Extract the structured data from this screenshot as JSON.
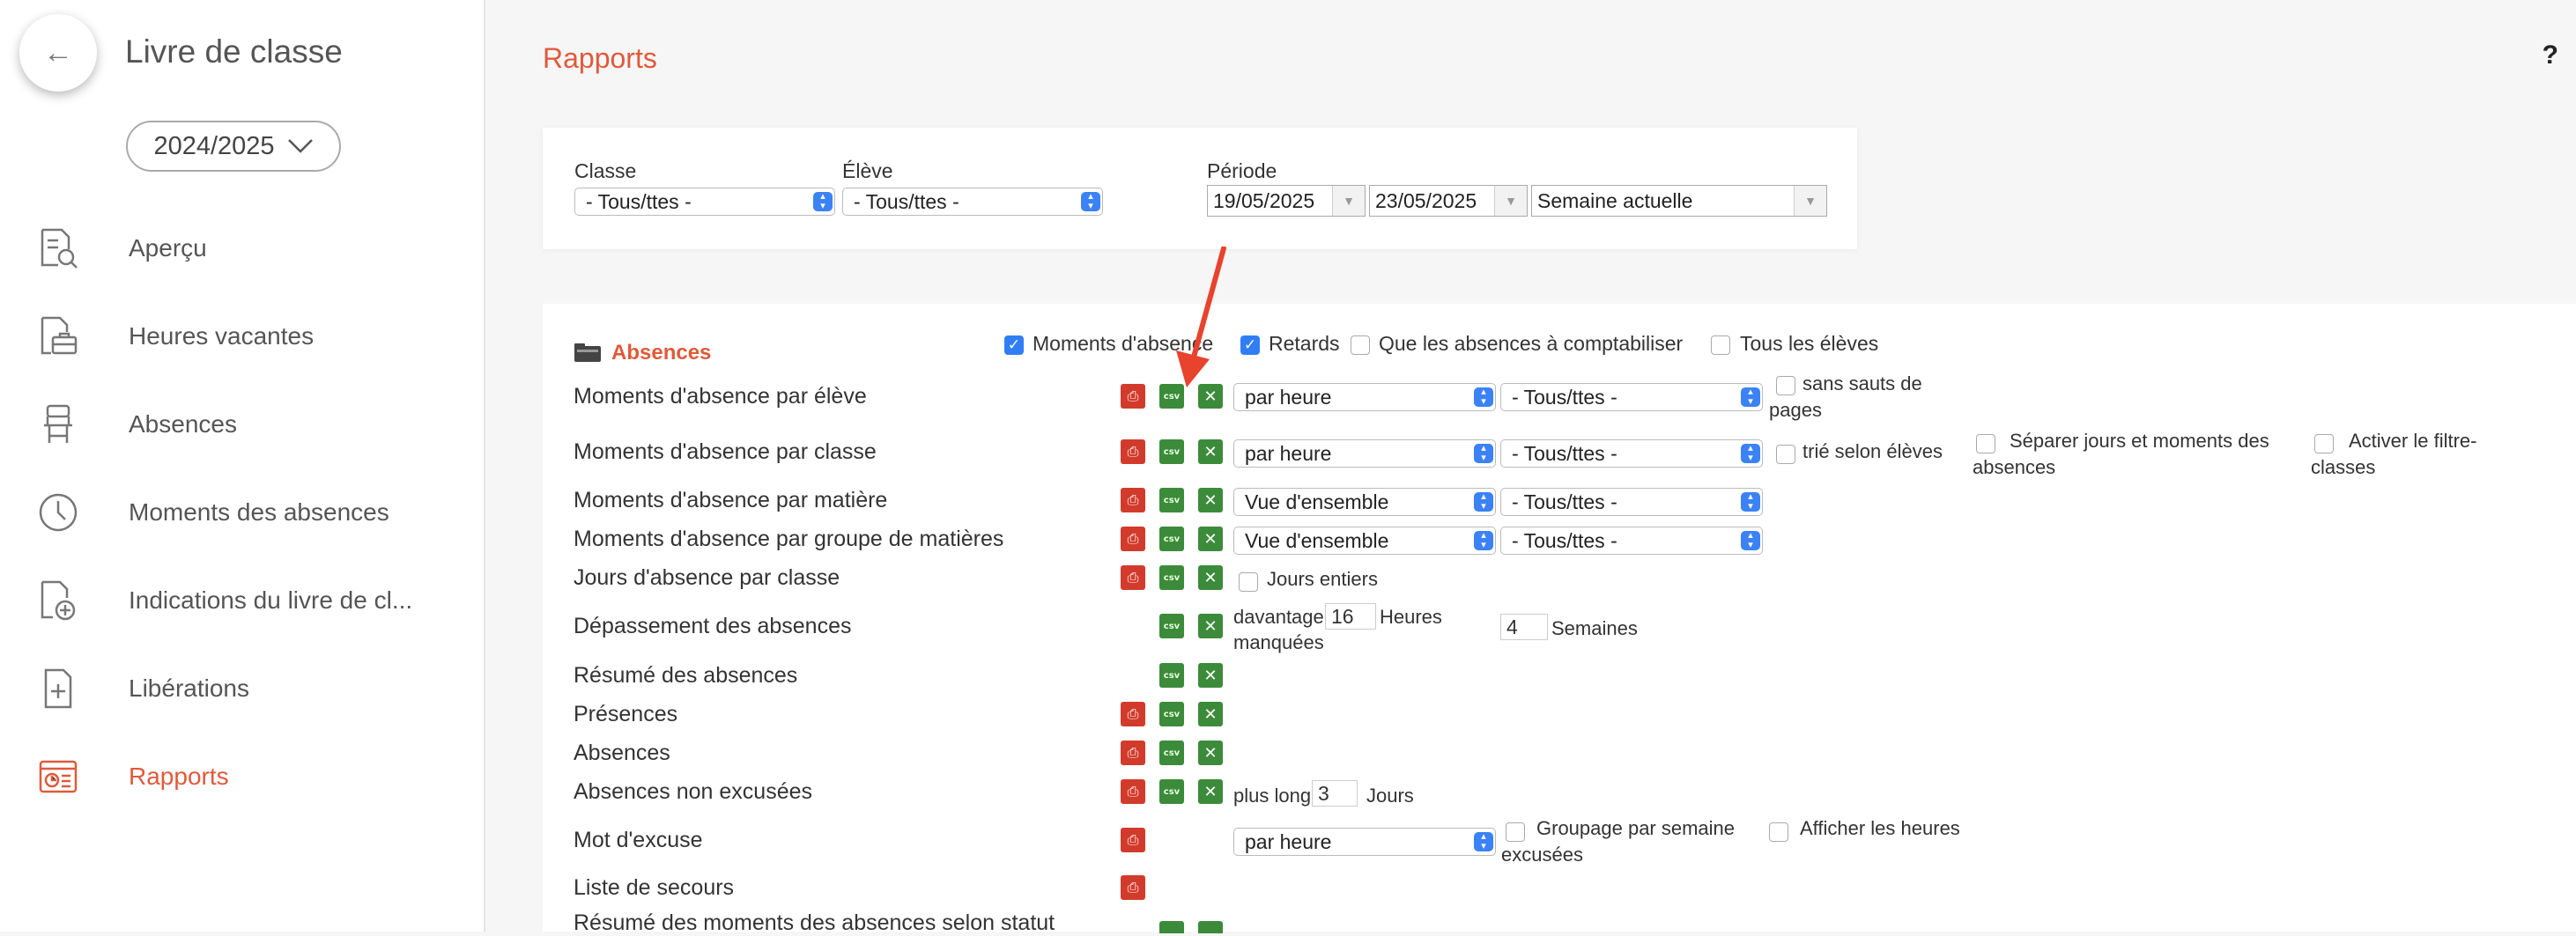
{
  "sidebar": {
    "title": "Livre de classe",
    "year": "2024/2025",
    "items": [
      {
        "label": "Aperçu",
        "icon": "document-search-icon"
      },
      {
        "label": "Heures vacantes",
        "icon": "briefcase-document-icon"
      },
      {
        "label": "Absences",
        "icon": "chair-icon"
      },
      {
        "label": "Moments des absences",
        "icon": "clock-icon"
      },
      {
        "label": "Indications du livre de cl...",
        "icon": "document-add-icon"
      },
      {
        "label": "Libérations",
        "icon": "document-plus-icon"
      },
      {
        "label": "Rapports",
        "icon": "report-icon"
      }
    ],
    "active": "Rapports"
  },
  "main": {
    "title": "Rapports",
    "help": "?"
  },
  "filters": {
    "classe_label": "Classe",
    "classe_value": "- Tous/ttes -",
    "eleve_label": "Élève",
    "eleve_value": "- Tous/ttes -",
    "periode_label": "Période",
    "date_from": "19/05/2025",
    "date_to": "23/05/2025",
    "periode_value": "Semaine actuelle"
  },
  "absences": {
    "title": "Absences",
    "opt_moments": "Moments d'absence",
    "opt_retards": "Retards",
    "opt_comptabiliser": "Que les absences à comptabiliser",
    "opt_tous": "Tous les élèves",
    "rows": [
      "Moments d'absence par élève",
      "Moments d'absence par classe",
      "Moments d'absence par matière",
      "Moments d'absence par groupe de matières",
      "Jours d'absence par classe",
      "Dépassement des absences",
      "Résumé des absences",
      "Présences",
      "Absences",
      "Absences non excusées",
      "Mot d'excuse",
      "Liste de secours",
      "Résumé des moments des absences selon statut"
    ],
    "sel_par_heure": "par heure",
    "sel_vue": "Vue d'ensemble",
    "sel_tous": "- Tous/ttes -",
    "sans_sauts_1": "sans sauts de",
    "sans_sauts_2": "pages",
    "trie": "trié selon élèves",
    "separer_1": "Séparer jours et moments des",
    "separer_2": "absences",
    "activer_1": "Activer le filtre-",
    "activer_2": "classes",
    "jours_entiers": "Jours entiers",
    "davantage": "davantage que",
    "heures_val": "16",
    "heures": "Heures",
    "manquees": "manquées",
    "semaines_val": "4",
    "semaines": "Semaines",
    "plus_long": "plus long que",
    "jours_val": "3",
    "jours": "Jours",
    "groupage_1": "Groupage par semaine",
    "groupage_2": "excusées",
    "afficher": "Afficher les heures",
    "csv": "csv"
  },
  "colors": {
    "accent": "#e05a3a",
    "select_blue": "#3b82f6",
    "excel_green": "#3c8b3a",
    "pdf_red": "#d23b2b",
    "arrow_red": "#e8432d"
  }
}
